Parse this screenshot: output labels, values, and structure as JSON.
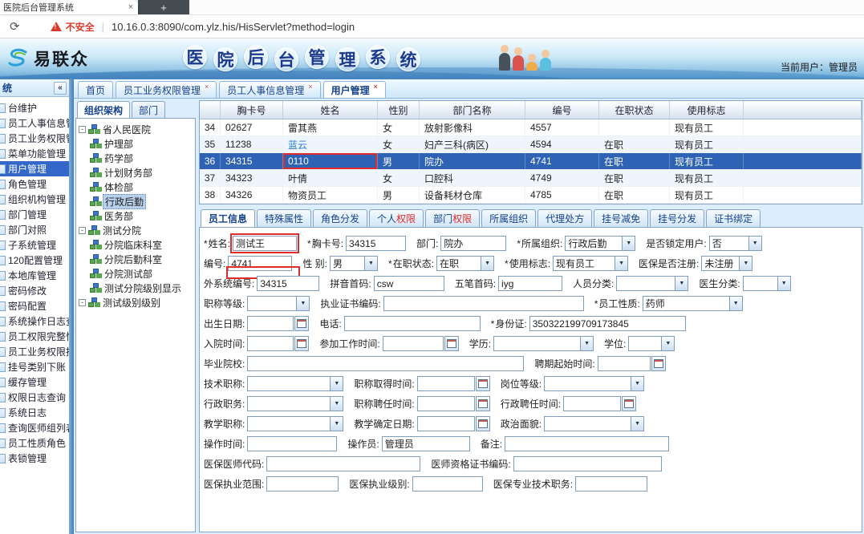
{
  "browser": {
    "tab_title": "医院后台管理系统",
    "tab_close": "×",
    "new_tab": "+",
    "refresh_icon": "⟳",
    "security_warning": "不安全",
    "url_separator": "|",
    "url": "10.16.0.3:8090/com.ylz.his/HisServlet?method=login"
  },
  "banner": {
    "logo_text": "易联众",
    "title_chars": [
      "医",
      "院",
      "后",
      "台",
      "管",
      "理",
      "系",
      "统"
    ],
    "current_user": "当前用户：管理员"
  },
  "sidebar": {
    "header": "统",
    "collapse": "«",
    "items": [
      {
        "label": "台维护"
      },
      {
        "label": "员工人事信息管"
      },
      {
        "label": "员工业务权限管"
      },
      {
        "label": "菜单功能管理"
      },
      {
        "label": "用户管理",
        "active": true
      },
      {
        "label": "角色管理"
      },
      {
        "label": "组织机构管理"
      },
      {
        "label": "部门管理"
      },
      {
        "label": "部门对照"
      },
      {
        "label": "子系统管理"
      },
      {
        "label": "120配置管理"
      },
      {
        "label": "本地库管理"
      },
      {
        "label": "密码修改"
      },
      {
        "label": "密码配置"
      },
      {
        "label": "系统操作日志查"
      },
      {
        "label": "员工权限完整性"
      },
      {
        "label": "员工业务权限授"
      },
      {
        "label": "挂号类别下账"
      },
      {
        "label": "缓存管理"
      },
      {
        "label": "权限日志查询"
      },
      {
        "label": "系统日志"
      },
      {
        "label": "查询医师组列表"
      },
      {
        "label": "员工性质角色"
      },
      {
        "label": "表锁管理"
      }
    ]
  },
  "page_tabs": [
    {
      "label": "首页",
      "closable": false,
      "active": false
    },
    {
      "label": "员工业务权限管理",
      "closable": true,
      "active": false
    },
    {
      "label": "员工人事信息管理",
      "closable": true,
      "active": false
    },
    {
      "label": "用户管理",
      "closable": true,
      "active": true
    }
  ],
  "tree_panel": {
    "tabs": [
      {
        "label": "组织架构",
        "active": true
      },
      {
        "label": "部门",
        "active": false
      }
    ],
    "nodes": [
      {
        "label": "省人民医院",
        "level": 0
      },
      {
        "label": "护理部",
        "level": 1
      },
      {
        "label": "药学部",
        "level": 1
      },
      {
        "label": "计划财务部",
        "level": 1
      },
      {
        "label": "体检部",
        "level": 1
      },
      {
        "label": "行政后勤",
        "level": 1,
        "selected": true
      },
      {
        "label": "医务部",
        "level": 1
      },
      {
        "label": "测试分院",
        "level": 0
      },
      {
        "label": "分院临床科室",
        "level": 1
      },
      {
        "label": "分院后勤科室",
        "level": 1
      },
      {
        "label": "分院测试部",
        "level": 1
      },
      {
        "label": "测试分院级别显示",
        "level": 1
      },
      {
        "label": "测试级别级别",
        "level": 0
      }
    ]
  },
  "employee_table": {
    "columns": [
      "",
      "胸卡号",
      "姓名",
      "性别",
      "部门名称",
      "编号",
      "在职状态",
      "使用标志"
    ],
    "rows": [
      {
        "cells": [
          "34",
          "02627",
          "雷其燕",
          "女",
          "放射影像科",
          "4557",
          "",
          "现有员工"
        ]
      },
      {
        "cells": [
          "35",
          "11238",
          "蓝云",
          "女",
          "妇产三科(病区)",
          "4594",
          "在职",
          "现有员工"
        ],
        "name_blue": true
      },
      {
        "cells": [
          "36",
          "34315",
          "0110",
          "男",
          "院办",
          "4741",
          "在职",
          "现有员工"
        ],
        "selected": true,
        "red_box_cell": 2
      },
      {
        "cells": [
          "37",
          "34323",
          "叶倩",
          "女",
          "口腔科",
          "4749",
          "在职",
          "现有员工"
        ]
      },
      {
        "cells": [
          "38",
          "34326",
          "物资员工",
          "男",
          "设备耗材仓库",
          "4785",
          "在职",
          "现有员工"
        ]
      }
    ]
  },
  "detail_tabs": [
    {
      "label": "员工信息",
      "active": true
    },
    {
      "label": "特殊属性"
    },
    {
      "label": "角色分发"
    },
    {
      "label": "个人",
      "highlight": "权限"
    },
    {
      "label": "部门",
      "highlight": "权限"
    },
    {
      "label": "所属组织"
    },
    {
      "label": "代理处方"
    },
    {
      "label": "挂号减免"
    },
    {
      "label": "挂号分发"
    },
    {
      "label": "证书绑定"
    }
  ],
  "employee_form": {
    "rows": [
      [
        {
          "id": "xingming",
          "label": "姓名",
          "required": true,
          "type": "text",
          "value": "测试王",
          "annotation": "red-box"
        },
        {
          "id": "xiongkahao",
          "label": "胸卡号",
          "required": true,
          "type": "text",
          "value": "34315"
        },
        {
          "id": "bumen",
          "label": "部门",
          "type": "text",
          "value": "院办"
        },
        {
          "id": "suoshuzuzhi",
          "label": "所属组织",
          "required": true,
          "type": "select",
          "value": "行政后勤"
        },
        {
          "id": "shifousuoding",
          "label": "是否锁定用户",
          "type": "select",
          "value": "否"
        }
      ],
      [
        {
          "id": "bianhao",
          "label": "编号",
          "type": "text",
          "value": "4741",
          "annotation": "red-under"
        },
        {
          "id": "xingbie",
          "label": "性 别",
          "type": "select",
          "value": "男"
        },
        {
          "id": "zaizhizhuangtai",
          "label": "在职状态",
          "required": true,
          "type": "select",
          "value": "在职"
        },
        {
          "id": "shiyongbiaozhi",
          "label": "使用标志",
          "required": true,
          "type": "select",
          "value": "现有员工"
        },
        {
          "id": "yibaoshifouzhuce",
          "label": "医保是否注册",
          "type": "select",
          "value": "未注册"
        }
      ],
      [
        {
          "id": "waixitongbianhao",
          "label": "外系统编号",
          "type": "text",
          "value": "34315"
        },
        {
          "id": "pinyinshouma",
          "label": "拼音首码",
          "type": "text",
          "value": "csw"
        },
        {
          "id": "wubishouma",
          "label": "五笔首码",
          "type": "text",
          "value": "iyg"
        },
        {
          "id": "renyuanfenlei",
          "label": "人员分类",
          "type": "select",
          "value": ""
        },
        {
          "id": "yishengfenlei",
          "label": "医生分类",
          "type": "select",
          "value": ""
        }
      ],
      [
        {
          "id": "zhichengdengji",
          "label": "职称等级",
          "type": "select",
          "value": ""
        },
        {
          "id": "zhiyezhengshubianma",
          "label": "执业证书编码",
          "type": "text",
          "value": ""
        },
        {
          "id": "yuangongxingzhi",
          "label": "员工性质",
          "required": true,
          "type": "select",
          "value": "药师"
        }
      ],
      [
        {
          "id": "chushengriqi",
          "label": "出生日期",
          "type": "date",
          "value": ""
        },
        {
          "id": "dianhua",
          "label": "电话",
          "type": "text",
          "value": ""
        },
        {
          "id": "shenfenzheng",
          "label": "身份证",
          "required": true,
          "type": "text",
          "value": "350322199709173845"
        }
      ],
      [
        {
          "id": "ruyuanshijian",
          "label": "入院时间",
          "type": "date",
          "value": ""
        },
        {
          "id": "canjiagongzuoshijian",
          "label": "参加工作时间",
          "type": "date",
          "value": ""
        },
        {
          "id": "xueli",
          "label": "学历",
          "type": "select",
          "value": ""
        },
        {
          "id": "xuewei",
          "label": "学位",
          "type": "select",
          "value": ""
        }
      ],
      [
        {
          "id": "biyeyuanxiao",
          "label": "毕业院校",
          "type": "text",
          "value": ""
        },
        {
          "id": "pinqiqishishijian",
          "label": "聘期起始时间",
          "type": "date",
          "value": ""
        }
      ],
      [
        {
          "id": "jishuzhicheng",
          "label": "技术职称",
          "type": "select",
          "value": ""
        },
        {
          "id": "zhichengqudeshijian",
          "label": "职称取得时间",
          "type": "date",
          "value": ""
        },
        {
          "id": "gangweidengji",
          "label": "岗位等级",
          "type": "select",
          "value": ""
        }
      ],
      [
        {
          "id": "xingzhengzhiwu",
          "label": "行政职务",
          "type": "select",
          "value": ""
        },
        {
          "id": "zhichengpinrenshijian",
          "label": "职称聘任时间",
          "type": "date",
          "value": ""
        },
        {
          "id": "xingzhengpinrenshijian",
          "label": "行政聘任时间",
          "type": "date",
          "value": ""
        }
      ],
      [
        {
          "id": "jiaoxuezhicheng",
          "label": "教学职称",
          "type": "select",
          "value": ""
        },
        {
          "id": "jiaoxuequedingriqi",
          "label": "教学确定日期",
          "type": "date",
          "value": ""
        },
        {
          "id": "zhengzhimianmao",
          "label": "政治面貌",
          "type": "select",
          "value": ""
        }
      ],
      [
        {
          "id": "caozuoshijian",
          "label": "操作时间",
          "type": "text",
          "value": ""
        },
        {
          "id": "caozuoyuan",
          "label": "操作员",
          "type": "text",
          "value": "管理员"
        },
        {
          "id": "beizhu",
          "label": "备注",
          "type": "text",
          "value": ""
        }
      ],
      [
        {
          "id": "yibaoyishidaima",
          "label": "医保医师代码",
          "type": "text",
          "value": ""
        },
        {
          "id": "yishizigezhengshubianma",
          "label": "医师资格证书编码",
          "type": "text",
          "value": ""
        }
      ],
      [
        {
          "id": "yibaozhiyefanwei",
          "label": "医保执业范围",
          "type": "text",
          "value": ""
        },
        {
          "id": "yibaozhiyejibie",
          "label": "医保执业级别",
          "type": "text",
          "value": ""
        },
        {
          "id": "yibaozhuanyejishuzhiwu",
          "label": "医保专业技术职务",
          "type": "text",
          "value": ""
        }
      ]
    ]
  }
}
